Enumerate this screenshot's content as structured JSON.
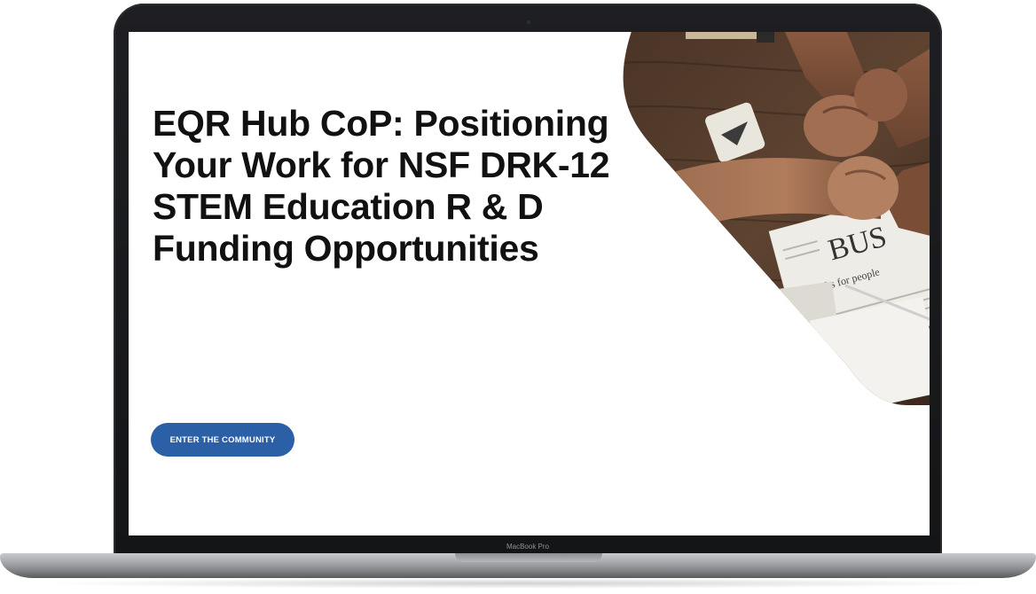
{
  "hero": {
    "title": "EQR Hub CoP: Positioning Your Work for NSF DRK-12 STEM Education R & D Funding Opportunities",
    "cta_label": "ENTER THE COMMUNITY"
  },
  "device": {
    "brand_label": "MacBook Pro"
  },
  "colors": {
    "button": "#2b5fa6",
    "title_text": "#111111",
    "bezel": "#1a1b1e"
  },
  "icons": {
    "photo": "fist-bump-over-newspaper-photo"
  }
}
